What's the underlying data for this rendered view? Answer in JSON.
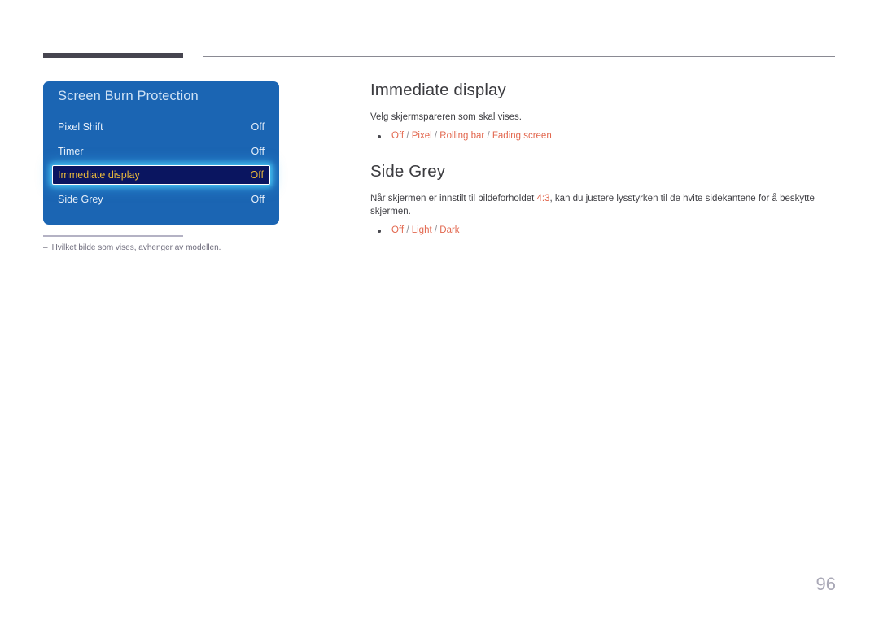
{
  "page": {
    "number": "96",
    "background": "#ffffff",
    "accent_color": "#e2674e",
    "header_bar_color": "#46454f"
  },
  "osd": {
    "title": "Screen Burn Protection",
    "panel_color": "#1b65b3",
    "selected_index": 2,
    "selected_text_color": "#e8b83c",
    "selected_fill_color": "#0a1560",
    "rows": [
      {
        "label": "Pixel Shift",
        "value": "Off"
      },
      {
        "label": "Timer",
        "value": "Off"
      },
      {
        "label": "Immediate display",
        "value": "Off"
      },
      {
        "label": "Side Grey",
        "value": "Off"
      }
    ]
  },
  "footnote": {
    "dash": "‒",
    "text": "Hvilket bilde som vises, avhenger av modellen."
  },
  "content": {
    "sections": [
      {
        "heading": "Immediate display",
        "description": "Velg skjermspareren som skal vises.",
        "options": [
          {
            "text": "Off",
            "sep": " / "
          },
          {
            "text": "Pixel",
            "sep": " / "
          },
          {
            "text": "Rolling bar",
            "sep": " / "
          },
          {
            "text": "Fading screen",
            "sep": ""
          }
        ]
      },
      {
        "heading": "Side Grey",
        "description_before": "Når skjermen er innstilt til bildeforholdet ",
        "description_accent": "4:3",
        "description_after": ", kan du justere lysstyrken til de hvite sidekantene for å beskytte skjermen.",
        "options": [
          {
            "text": "Off",
            "sep": " / "
          },
          {
            "text": "Light",
            "sep": " / "
          },
          {
            "text": "Dark",
            "sep": ""
          }
        ]
      }
    ]
  }
}
